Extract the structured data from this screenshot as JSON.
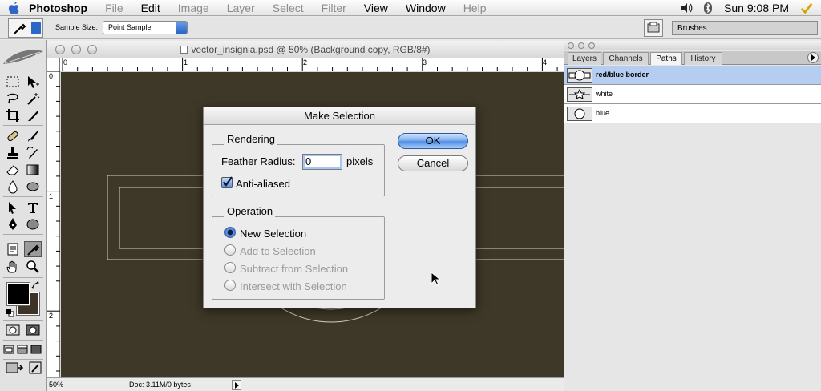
{
  "menubar": {
    "app_name": "Photoshop",
    "menus": [
      {
        "label": "File",
        "enabled": false
      },
      {
        "label": "Edit",
        "enabled": true
      },
      {
        "label": "Image",
        "enabled": false
      },
      {
        "label": "Layer",
        "enabled": false
      },
      {
        "label": "Select",
        "enabled": false
      },
      {
        "label": "Filter",
        "enabled": false
      },
      {
        "label": "View",
        "enabled": true
      },
      {
        "label": "Window",
        "enabled": true
      },
      {
        "label": "Help",
        "enabled": false
      }
    ],
    "clock": "Sun 9:08 PM",
    "tray_icons": [
      "volume-icon",
      "bluetooth-icon",
      "script-check-icon"
    ]
  },
  "options_bar": {
    "sample_size_label": "Sample Size:",
    "sample_size_value": "Point Sample",
    "brushes_tab": "Brushes"
  },
  "document": {
    "title": "vector_insignia.psd @ 50% (Background copy, RGB/8#)",
    "ruler_h_ticks": [
      "0",
      "1",
      "2",
      "3",
      "4"
    ],
    "ruler_v_ticks": [
      "0",
      "1",
      "2"
    ],
    "status_zoom": "50%",
    "status_doc": "Doc: 3.11M/0 bytes",
    "canvas_color": "#3e3828"
  },
  "panel": {
    "tabs": [
      {
        "label": "Layers",
        "active": false
      },
      {
        "label": "Channels",
        "active": false
      },
      {
        "label": "Paths",
        "active": true
      },
      {
        "label": "History",
        "active": false
      }
    ],
    "paths": [
      {
        "name": "red/blue border",
        "selected": true
      },
      {
        "name": "white",
        "selected": false
      },
      {
        "name": "blue",
        "selected": false
      }
    ]
  },
  "dialog": {
    "title": "Make Selection",
    "rendering_group": "Rendering",
    "feather_label": "Feather Radius:",
    "feather_value": "0",
    "feather_unit": "pixels",
    "anti_aliased_label": "Anti-aliased",
    "anti_aliased_checked": true,
    "operation_group": "Operation",
    "operations": [
      {
        "label": "New Selection",
        "selected": true,
        "enabled": true
      },
      {
        "label": "Add to Selection",
        "selected": false,
        "enabled": false
      },
      {
        "label": "Subtract from Selection",
        "selected": false,
        "enabled": false
      },
      {
        "label": "Intersect with Selection",
        "selected": false,
        "enabled": false
      }
    ],
    "ok_label": "OK",
    "cancel_label": "Cancel"
  },
  "colors": {
    "accent": "#2a63c4",
    "selection_row": "#b4cdf0",
    "foreground_swatch": "#000000",
    "background_swatch": "#3d3427"
  }
}
